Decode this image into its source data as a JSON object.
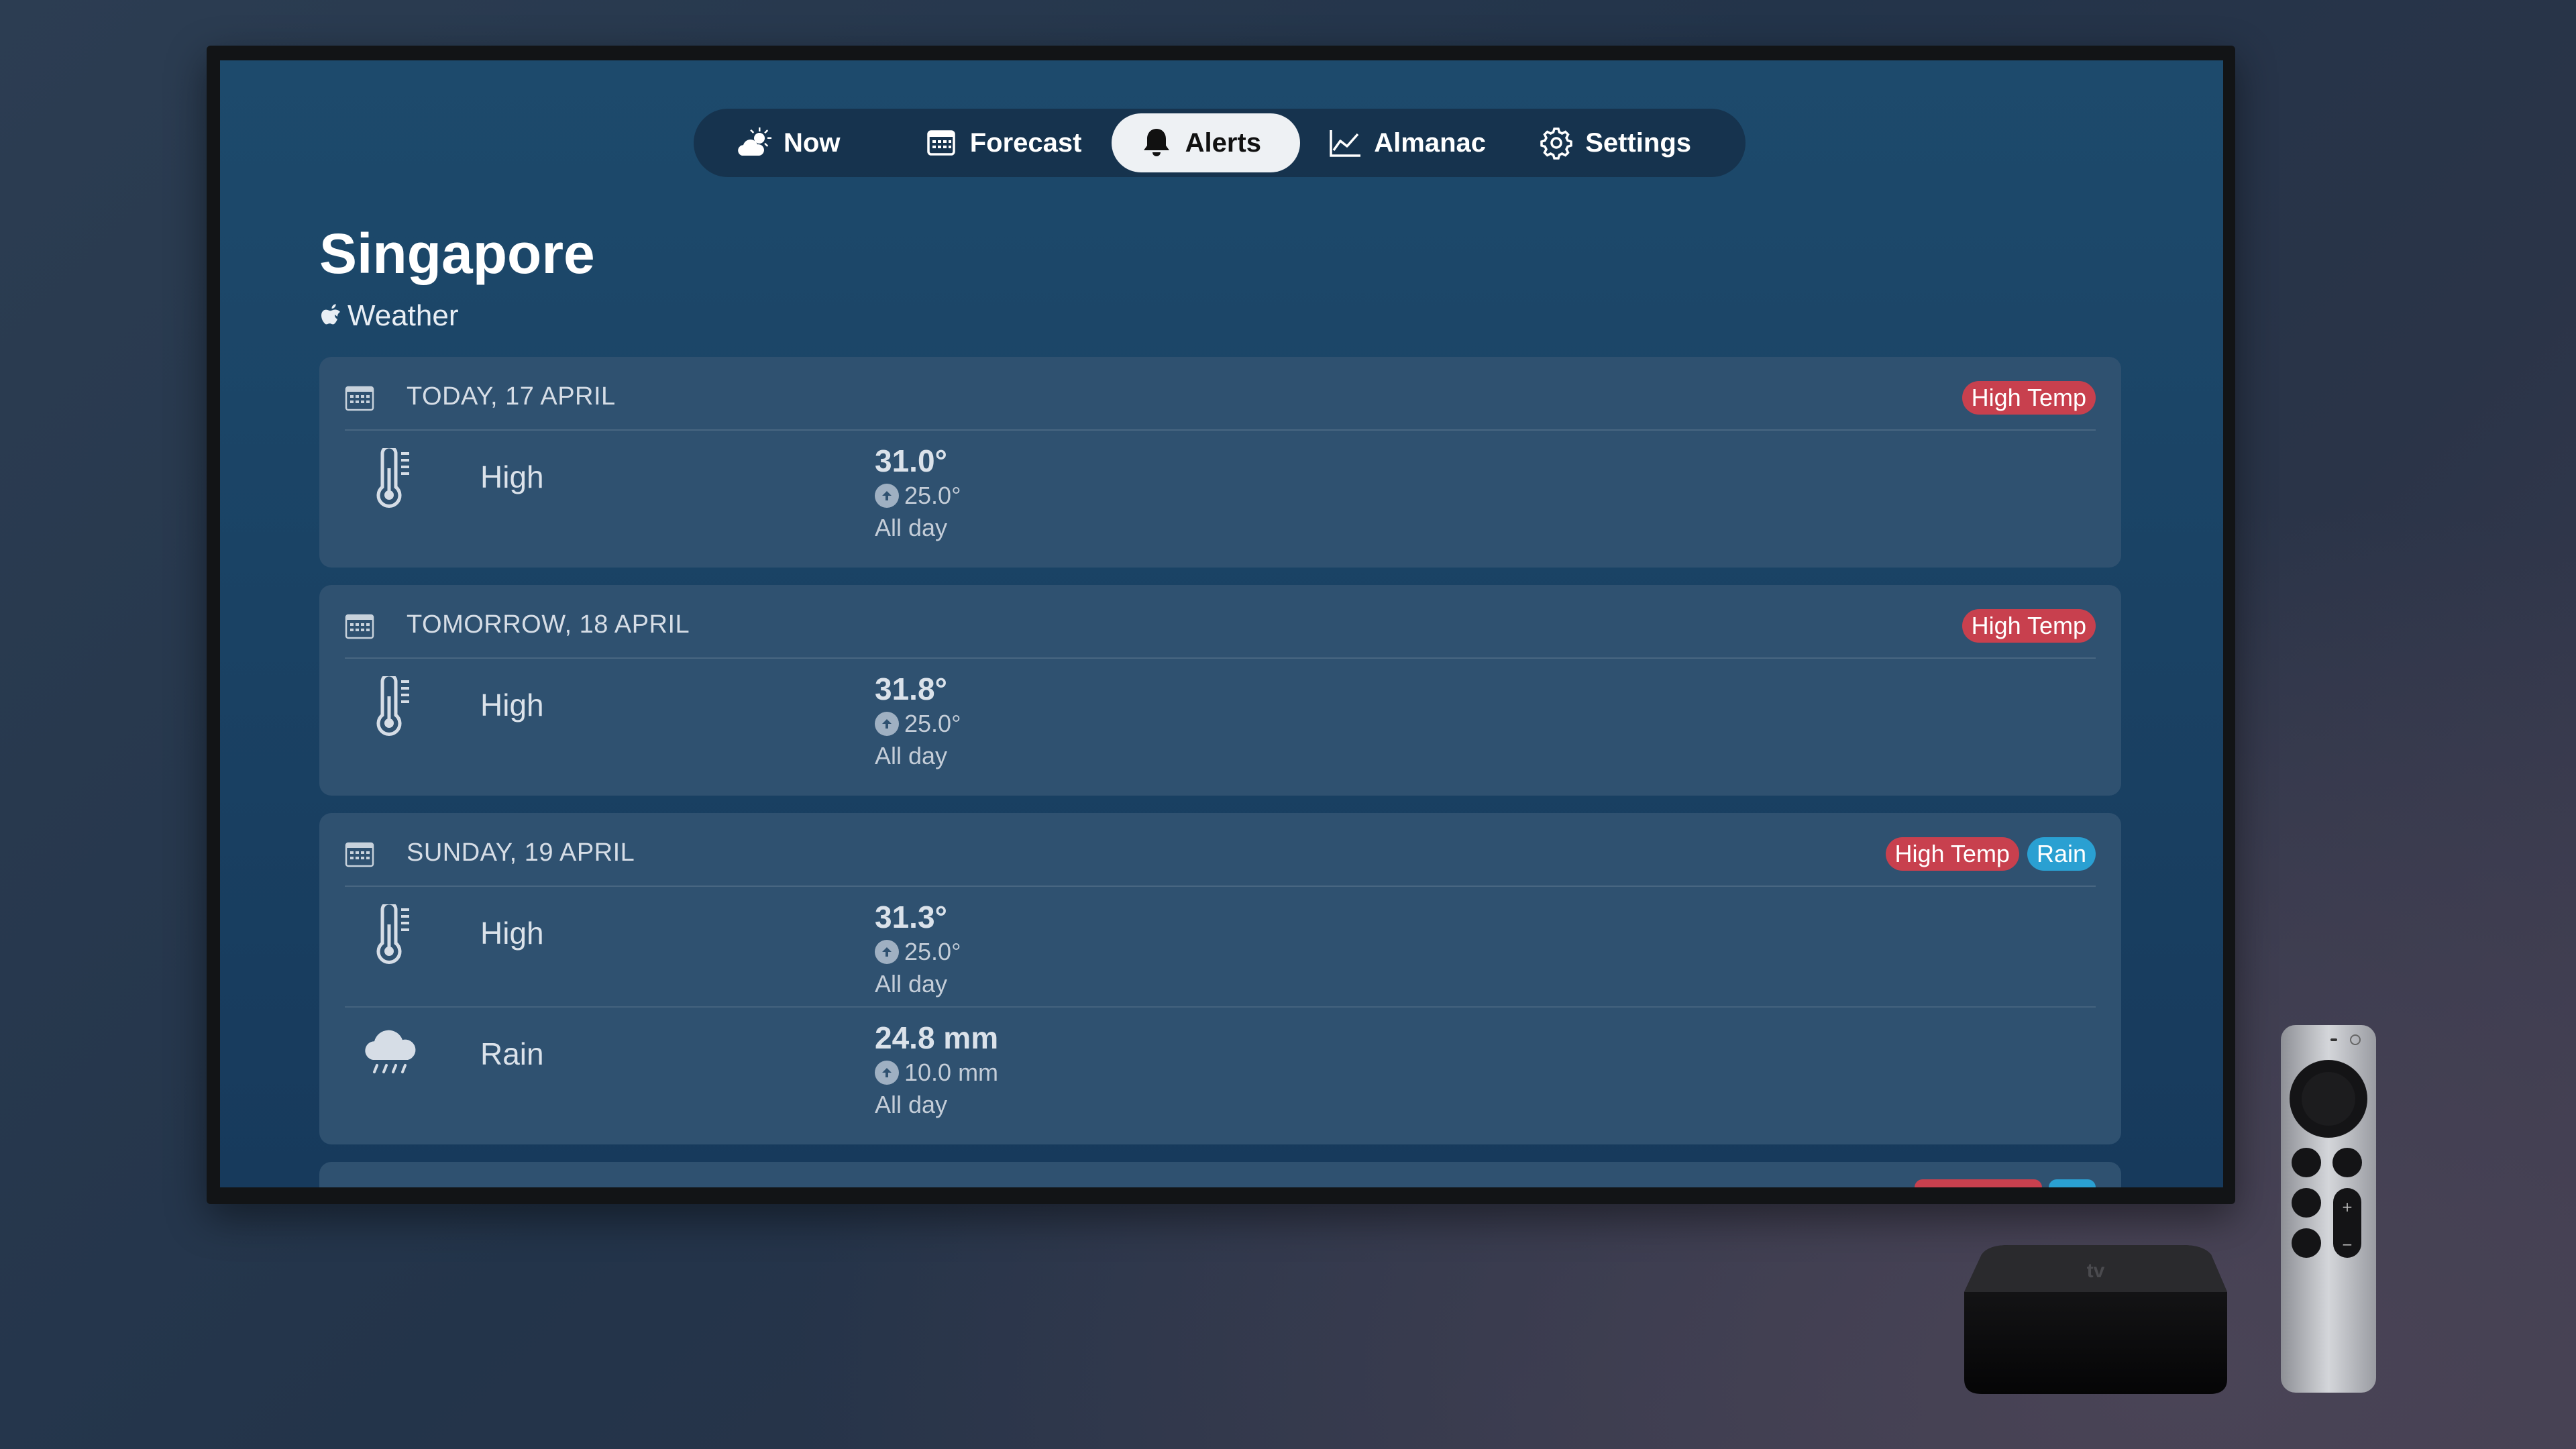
{
  "nav": {
    "tabs": [
      {
        "label": "Now",
        "icon": "sun-cloud-icon"
      },
      {
        "label": "Forecast",
        "icon": "calendar-icon"
      },
      {
        "label": "Alerts",
        "icon": "bell-icon",
        "active": true
      },
      {
        "label": "Almanac",
        "icon": "line-chart-icon"
      },
      {
        "label": "Settings",
        "icon": "gear-icon"
      }
    ]
  },
  "header": {
    "title": "Singapore",
    "subtitle": "Weather"
  },
  "alerts": [
    {
      "date": "TODAY, 17 APRIL",
      "badges": [
        "High Temp"
      ],
      "rows": [
        {
          "icon": "thermometer-icon",
          "label": "High",
          "value": "31.0°",
          "threshold": "25.0°",
          "duration": "All day"
        }
      ]
    },
    {
      "date": "TOMORROW, 18 APRIL",
      "badges": [
        "High Temp"
      ],
      "rows": [
        {
          "icon": "thermometer-icon",
          "label": "High",
          "value": "31.8°",
          "threshold": "25.0°",
          "duration": "All day"
        }
      ]
    },
    {
      "date": "SUNDAY, 19 APRIL",
      "badges": [
        "High Temp",
        "Rain"
      ],
      "rows": [
        {
          "icon": "thermometer-icon",
          "label": "High",
          "value": "31.3°",
          "threshold": "25.0°",
          "duration": "All day"
        },
        {
          "icon": "rain-cloud-icon",
          "label": "Rain",
          "value": "24.8 mm",
          "threshold": "10.0 mm",
          "duration": "All day"
        }
      ]
    }
  ],
  "colors": {
    "high_temp_badge": "#c8404e",
    "rain_badge": "#2aa0d2",
    "card": "#2f5170",
    "screen": "#1a4264"
  }
}
